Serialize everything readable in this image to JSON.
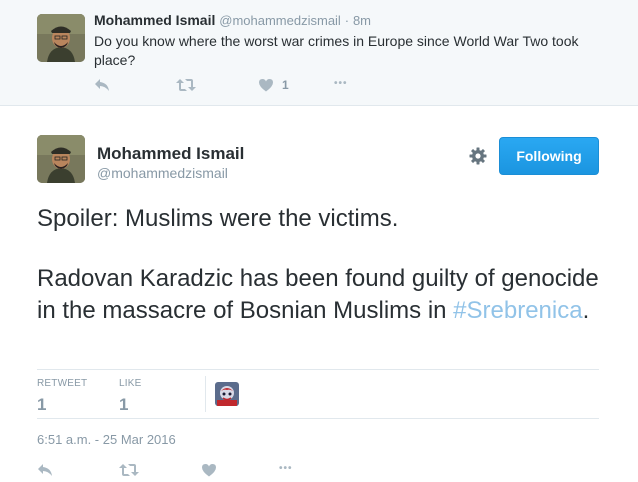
{
  "parent_tweet": {
    "name": "Mohammed Ismail",
    "handle": "@mohammedzismail",
    "dot": "·",
    "time": "8m",
    "text": "Do you know where the worst war crimes in Europe since World War Two took place?",
    "like_count": "1",
    "more": "•••"
  },
  "main_tweet": {
    "name": "Mohammed Ismail",
    "handle": "@mohammedzismail",
    "follow_label": "Following",
    "line1": "Spoiler: Muslims were the victims.",
    "line2_text": "Radovan Karadzic has been found guilty of genocide in the massacre of Bosnian Muslims in ",
    "hashtag": "#Srebrenica",
    "line2_end": ".",
    "retweet_label": "RETWEET",
    "retweet_count": "1",
    "like_label": "LIKE",
    "like_count": "1",
    "timestamp": "6:51 a.m. - 25 Mar 2016",
    "more": "•••"
  },
  "colors": {
    "accent": "#1da1f2",
    "hashtag": "#91c3e8",
    "muted": "#8899a6",
    "icon": "#aab8c2"
  }
}
